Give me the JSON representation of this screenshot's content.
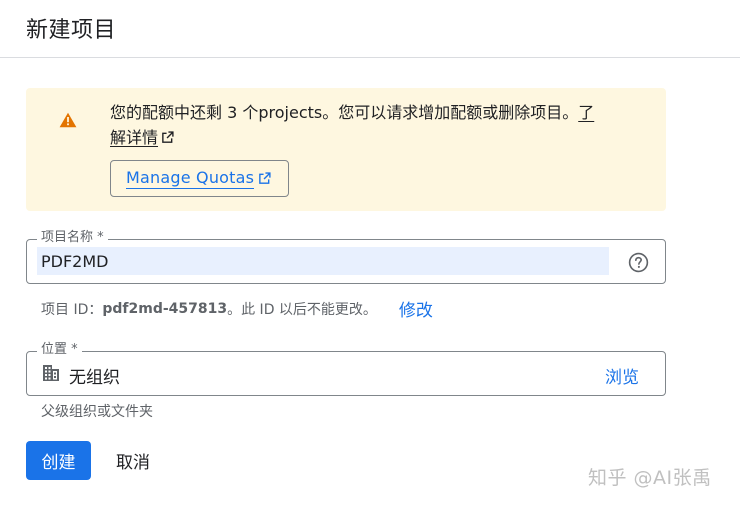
{
  "page": {
    "title": "新建项目"
  },
  "banner": {
    "message_prefix": "您的配额中还剩 3 个projects。您可以请求增加配额或删除项目。",
    "learn_more_part1": "了",
    "learn_more_part2": "解详情",
    "manage_quotas_label": "Manage Quotas",
    "accent_color": "#e37400",
    "background_color": "#fef7e0"
  },
  "project_name": {
    "label": "项目名称 *",
    "value": "PDF2MD",
    "help_icon": "help-circle-icon"
  },
  "project_id": {
    "prefix": "项目 ID：",
    "value": "pdf2md-457813",
    "suffix": "。此 ID 以后不能更改。",
    "edit_label": "修改"
  },
  "location": {
    "label": "位置 *",
    "value": "无组织",
    "browse_label": "浏览",
    "hint": "父级组织或文件夹",
    "icon": "building-icon"
  },
  "actions": {
    "create_label": "创建",
    "cancel_label": "取消",
    "primary_color": "#1a73e8"
  },
  "watermark": {
    "text": "知乎 @AI张禹"
  }
}
